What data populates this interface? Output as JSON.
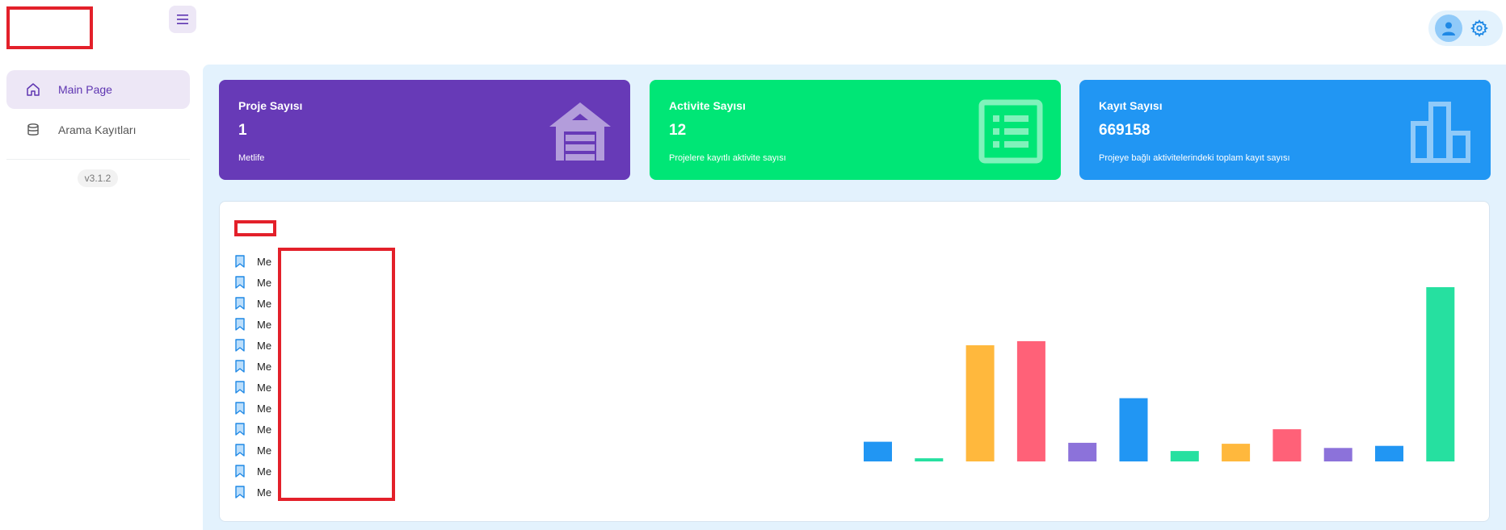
{
  "header": {
    "menu_icon": "hamburger-icon",
    "user_icon": "user-icon",
    "settings_icon": "gear-icon"
  },
  "sidebar": {
    "items": [
      {
        "label": "Main Page",
        "icon": "home-icon",
        "active": true
      },
      {
        "label": "Arama Kayıtları",
        "icon": "database-icon",
        "active": false
      }
    ],
    "version": "v3.1.2"
  },
  "cards": [
    {
      "title": "Proje Sayısı",
      "value": "1",
      "subtitle": "Metlife",
      "icon": "warehouse-icon",
      "color": "#673ab7"
    },
    {
      "title": "Activite Sayısı",
      "value": "12",
      "subtitle": "Projelere kayıtlı aktivite sayısı",
      "icon": "list-icon",
      "color": "#00e676"
    },
    {
      "title": "Kayıt Sayısı",
      "value": "669158",
      "subtitle": "Projeye bağlı aktivitelerindeki toplam kayıt sayısı",
      "icon": "bar-chart-icon",
      "color": "#2196f3"
    }
  ],
  "legend": {
    "items": [
      "Me",
      "Me",
      "Me",
      "Me",
      "Me",
      "Me",
      "Me",
      "Me",
      "Me",
      "Me",
      "Me",
      "Me"
    ]
  },
  "chart_data": {
    "type": "bar",
    "title": "",
    "xlabel": "",
    "ylabel": "",
    "grid": false,
    "values": [
      19,
      3,
      112,
      116,
      18,
      61,
      10,
      17,
      31,
      13,
      15,
      168
    ],
    "colors": [
      "#2196f3",
      "#26e0a0",
      "#ffb83d",
      "#ff6178",
      "#8c72da",
      "#2196f3",
      "#26e0a0",
      "#ffb83d",
      "#ff6178",
      "#8c72da",
      "#2196f3",
      "#26e0a0"
    ]
  }
}
